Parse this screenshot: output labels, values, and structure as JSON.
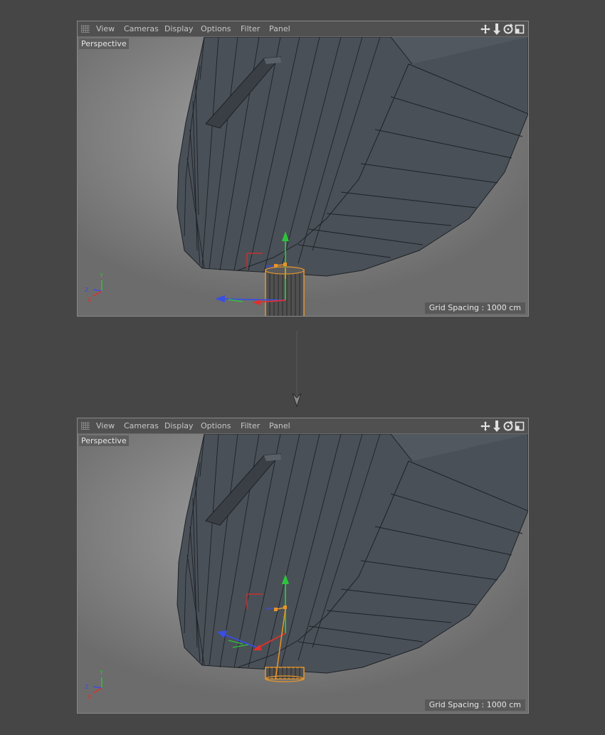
{
  "viewports": [
    {
      "menu": {
        "items": [
          "View",
          "Cameras",
          "Display",
          "Options",
          "Filter",
          "Panel"
        ]
      },
      "nav_icons": [
        "move-view-icon",
        "zoom-view-icon",
        "rotate-view-icon",
        "maximize-view-icon"
      ],
      "view_label": "Perspective",
      "grid_spacing": "Grid Spacing : 1000 cm",
      "axis_letters": {
        "y": "Y",
        "z": "Z",
        "x": "X"
      }
    },
    {
      "menu": {
        "items": [
          "View",
          "Cameras",
          "Display",
          "Options",
          "Filter",
          "Panel"
        ]
      },
      "nav_icons": [
        "move-view-icon",
        "zoom-view-icon",
        "rotate-view-icon",
        "maximize-view-icon"
      ],
      "view_label": "Perspective",
      "grid_spacing": "Grid Spacing : 1000 cm",
      "axis_letters": {
        "y": "Y",
        "z": "Z",
        "x": "X"
      }
    }
  ],
  "colors": {
    "mesh": "#4a5058",
    "mesh_edge": "#1e2226",
    "selection": "#e8962a",
    "axis_x": "#e0302a",
    "axis_y": "#2ec43a",
    "axis_z": "#3a4ee0"
  }
}
